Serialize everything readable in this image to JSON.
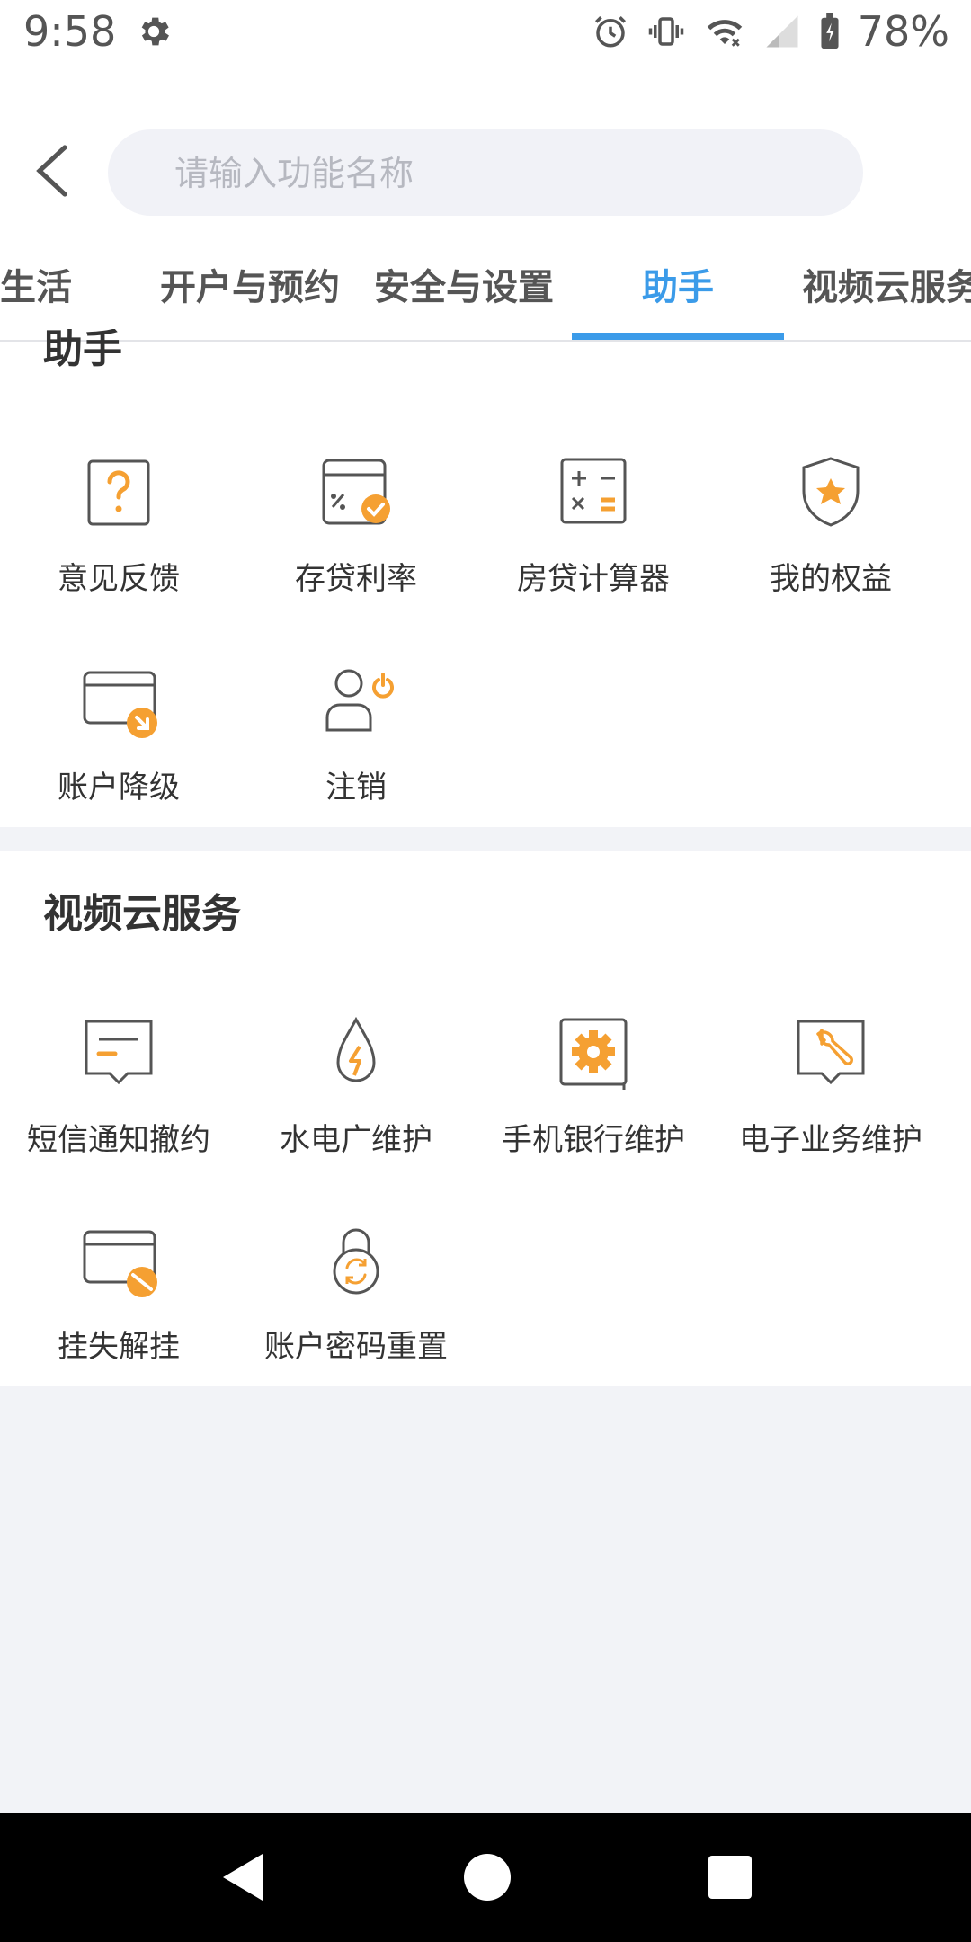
{
  "status_bar": {
    "time": "9:58",
    "battery": "78%"
  },
  "search": {
    "placeholder": "请输入功能名称"
  },
  "tabs": [
    {
      "label": "生活"
    },
    {
      "label": "开户与预约"
    },
    {
      "label": "安全与设置"
    },
    {
      "label": "助手",
      "active": true
    },
    {
      "label": "视频云服务"
    }
  ],
  "sections": [
    {
      "title": "助手",
      "items": [
        {
          "label": "意见反馈",
          "icon": "question-icon"
        },
        {
          "label": "存贷利率",
          "icon": "interest-rate-icon"
        },
        {
          "label": "房贷计算器",
          "icon": "calculator-icon"
        },
        {
          "label": "我的权益",
          "icon": "shield-star-icon"
        },
        {
          "label": "账户降级",
          "icon": "card-downgrade-icon"
        },
        {
          "label": "注销",
          "icon": "user-logout-icon"
        }
      ]
    },
    {
      "title": "视频云服务",
      "items": [
        {
          "label": "短信通知撤约",
          "icon": "sms-icon"
        },
        {
          "label": "水电广维护",
          "icon": "water-electric-icon"
        },
        {
          "label": "手机银行维护",
          "icon": "gear-icon"
        },
        {
          "label": "电子业务维护",
          "icon": "wrench-icon"
        },
        {
          "label": "挂失解挂",
          "icon": "card-block-icon"
        },
        {
          "label": "账户密码重置",
          "icon": "lock-reset-icon"
        }
      ]
    }
  ],
  "colors": {
    "accent": "#3b9be9",
    "icon_orange": "#f5a032",
    "icon_gray": "#555555"
  }
}
